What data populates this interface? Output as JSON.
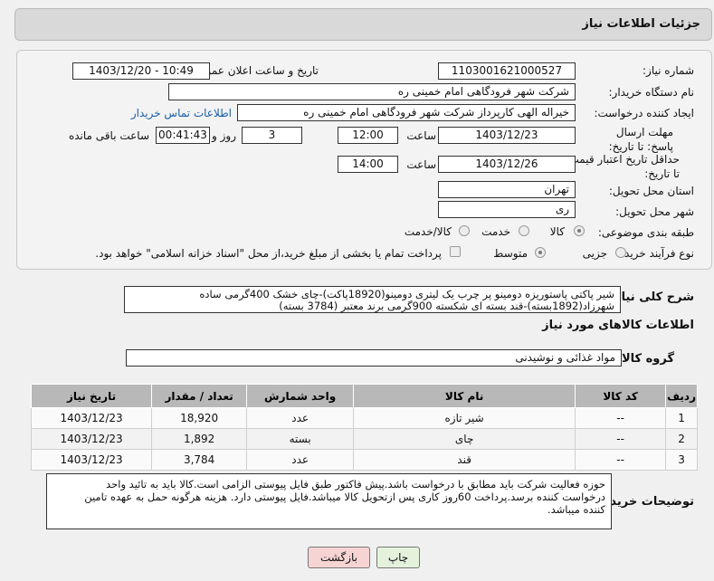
{
  "header": {
    "title": "جزئیات اطلاعات نیاز"
  },
  "form": {
    "need_number_label": "شماره نیاز:",
    "need_number": "1103001621000527",
    "announce_label": "تاریخ و ساعت اعلان عمومی:",
    "announce_value": "1403/12/20 - 10:49",
    "buyer_org_label": "نام دستگاه خریدار:",
    "buyer_org": "شرکت شهر فرودگاهی امام خمینی  ره",
    "creator_label": "ایجاد کننده درخواست:",
    "creator": "خیراله الهی کارپرداز شرکت شهر فرودگاهی امام خمینی  ره",
    "contact_link": "اطلاعات تماس خریدار",
    "deadline_label": "مهلت ارسال پاسخ: تا تاریخ:",
    "deadline_date": "1403/12/23",
    "time_label": "ساعت",
    "deadline_time": "12:00",
    "days": "3",
    "days_label": "روز و",
    "remaining_time": "00:41:43",
    "remaining_label": "ساعت باقی مانده",
    "validity_label": "حداقل تاریخ اعتبار قیمت: تا تاریخ:",
    "validity_date": "1403/12/26",
    "validity_time": "14:00",
    "province_label": "استان محل تحویل:",
    "province": "تهران",
    "city_label": "شهر محل تحویل:",
    "city": "ری",
    "category_label": "طبقه بندی موضوعی:",
    "category_options": [
      "کالا",
      "خدمت",
      "کالا/خدمت"
    ],
    "purchase_type_label": "نوع فرآیند خرید :",
    "purchase_options": [
      "جزیی",
      "متوسط"
    ],
    "payment_note": "پرداخت تمام یا بخشی از مبلغ خرید،از محل \"اسناد خزانه اسلامی\" خواهد بود."
  },
  "summary": {
    "label": "شرح کلی نیاز:",
    "line1": "شیر پاکتی پاستوریزه دومینو پر چرب یک لیتری دومینو(18920پاکت)-چای خشک 400گرمی ساده",
    "line2": "شهرزاد(1892بسته)-قند بسته ای شکسته 900گرمی برند معتبر (3784 بسته)"
  },
  "goods": {
    "section_title": "اطلاعات کالاهای مورد نیاز",
    "group_label": "گروه کالا:",
    "group_value": "مواد غذائی و نوشیدنی",
    "columns": [
      "ردیف",
      "کد کالا",
      "نام کالا",
      "واحد شمارش",
      "تعداد / مقدار",
      "تاریخ نیاز"
    ],
    "rows": [
      [
        "1",
        "--",
        "شیر تازه",
        "عدد",
        "18,920",
        "1403/12/23"
      ],
      [
        "2",
        "--",
        "چای",
        "بسته",
        "1,892",
        "1403/12/23"
      ],
      [
        "3",
        "--",
        "قند",
        "عدد",
        "3,784",
        "1403/12/23"
      ]
    ]
  },
  "buyer_notes": {
    "label": "توضیحات خریدار:",
    "line1": "حوزه فعالیت شرکت باید مطابق با درخواست باشد.پیش فاکتور طبق فایل پیوستی الزامی است.کالا باید به تائید واحد",
    "line2": "درخواست کننده برسد.پرداخت 60روز کاری پس ازتحویل کالا میباشد.فایل پیوستی دارد. هزینه هرگونه حمل به عهده تامین",
    "line3": "کننده میباشد."
  },
  "buttons": {
    "print": "چاپ",
    "back": "بازگشت"
  },
  "colors": {
    "link": "#1a5ea8",
    "back_button": "#f7d4d4",
    "print_button": "#e4f2dc"
  }
}
